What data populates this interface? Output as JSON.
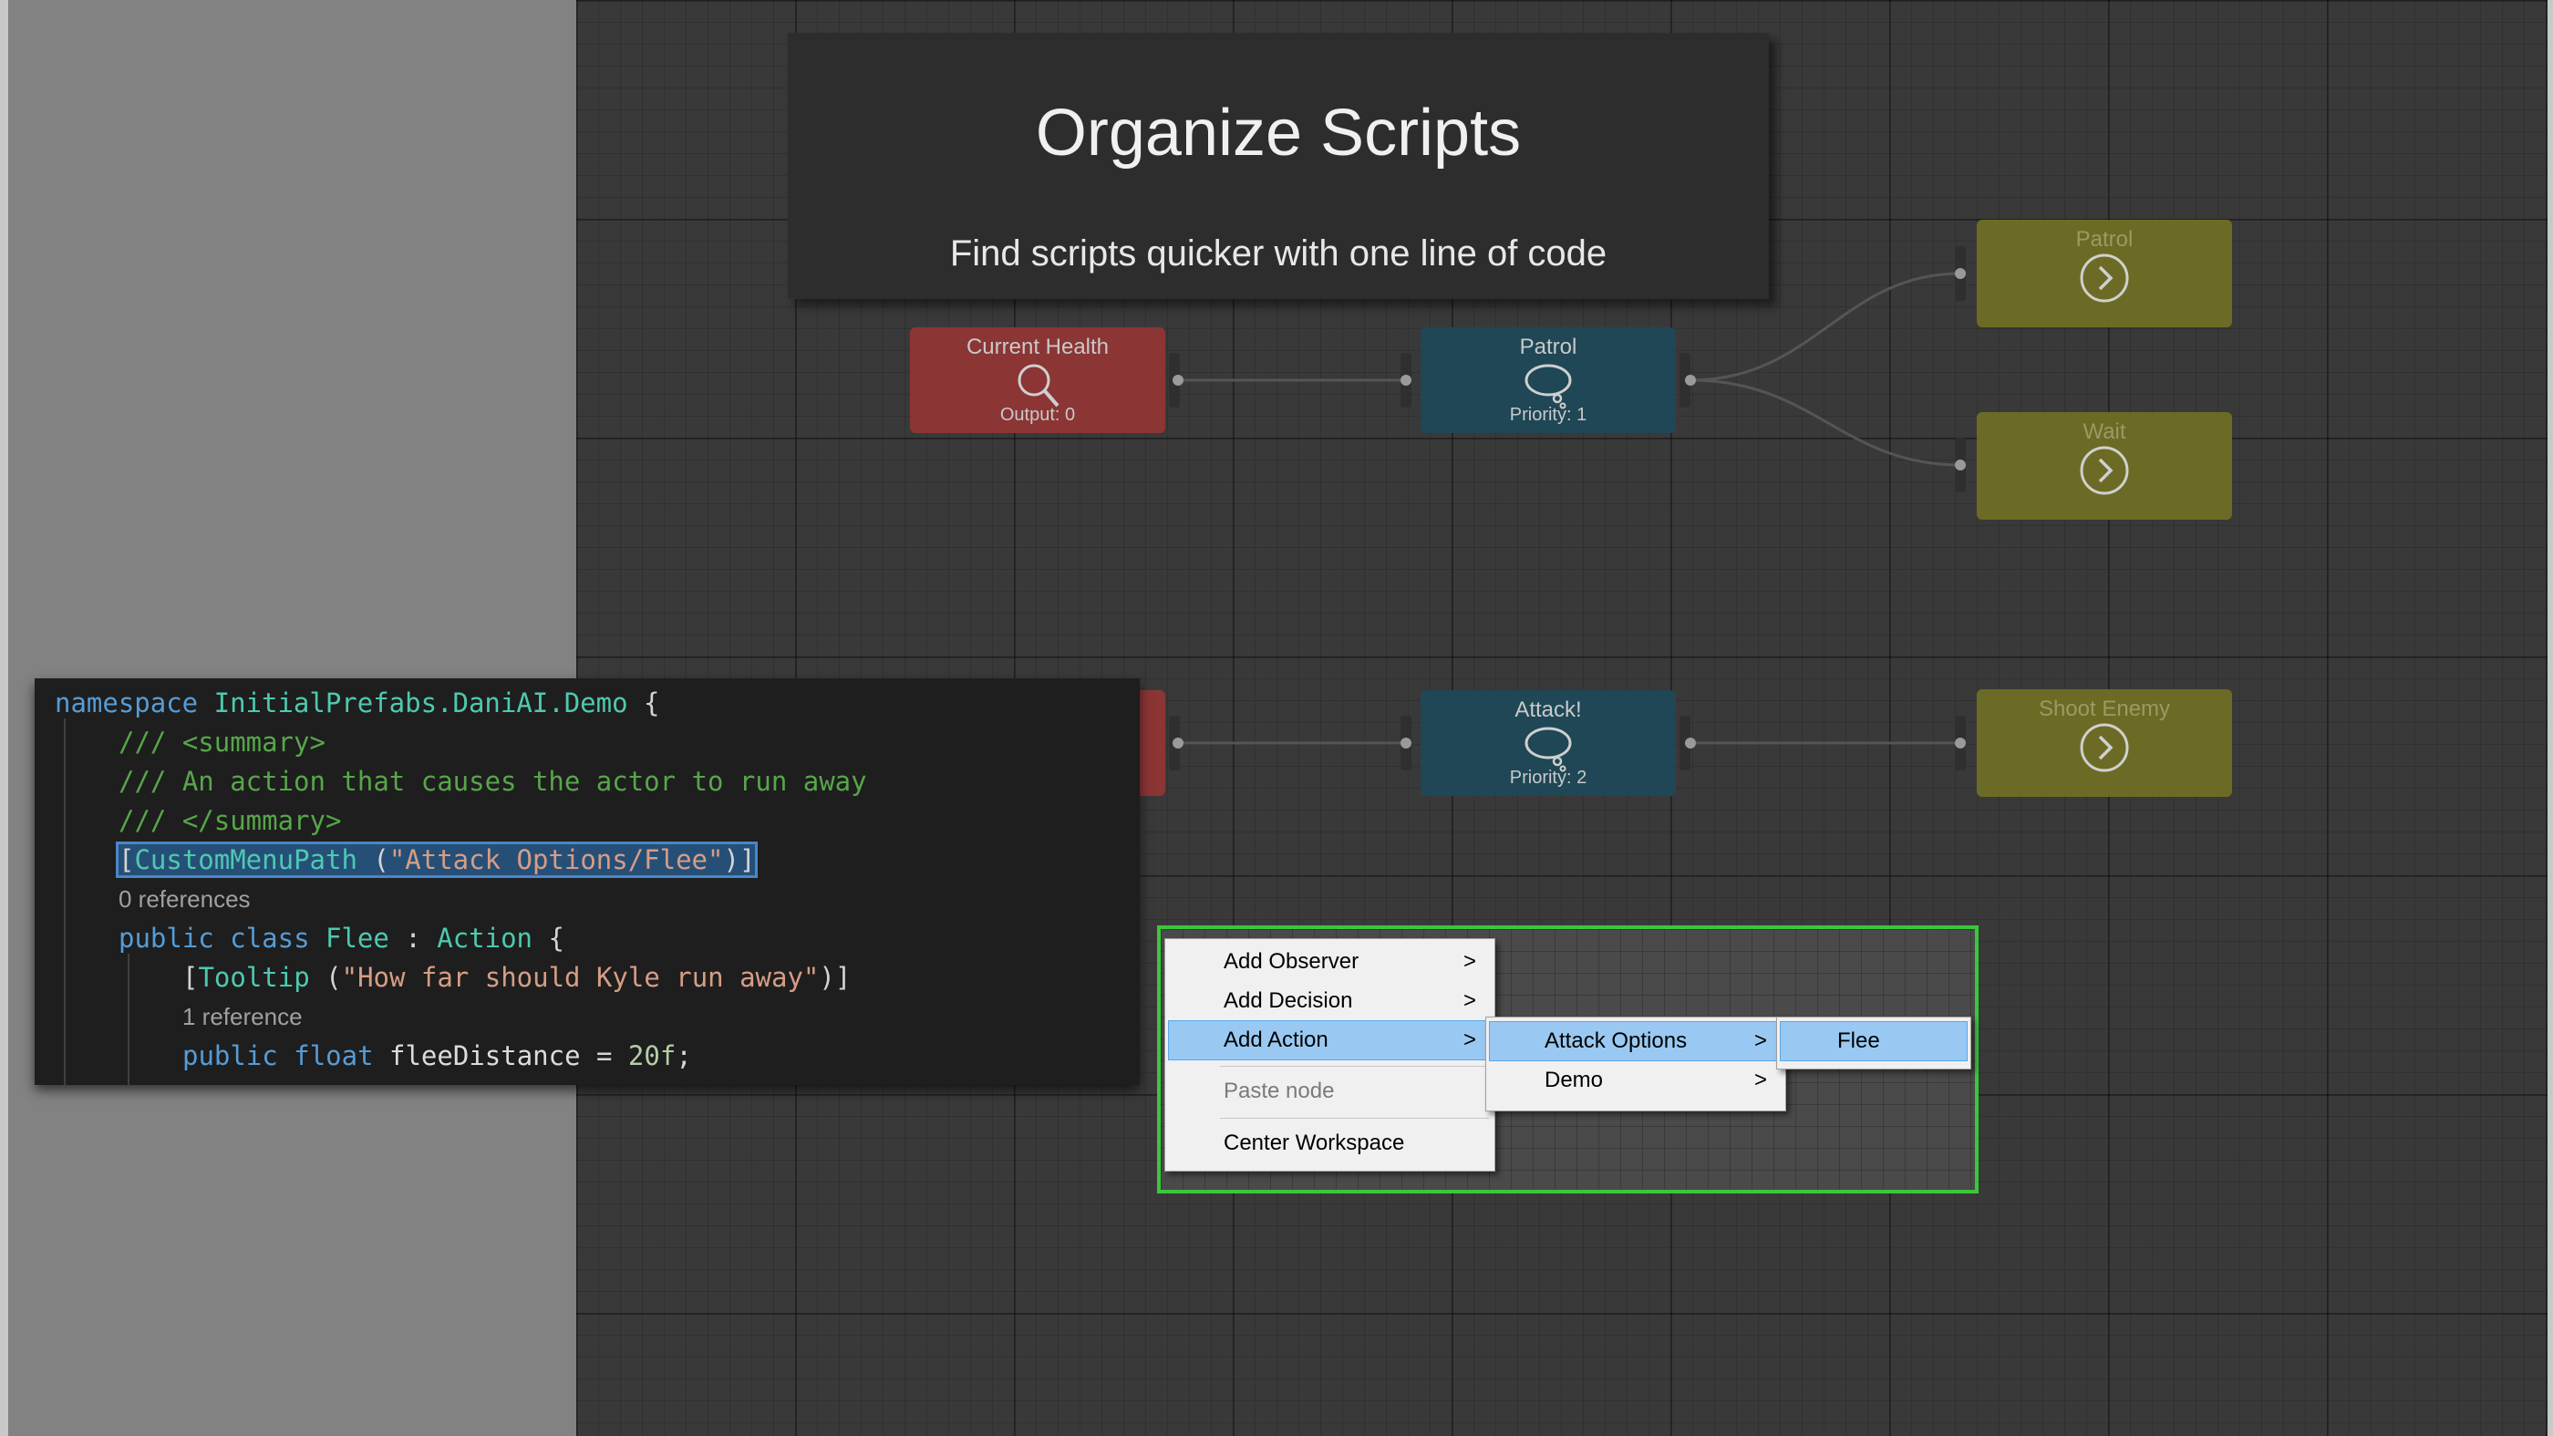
{
  "title_card": {
    "title": "Organize Scripts",
    "subtitle": "Find scripts quicker with one line of code"
  },
  "nodes": [
    {
      "name": "current-health",
      "title": "Current Health",
      "sub": "Output: 0",
      "color": "#8c3535",
      "icon": "magnifier-icon"
    },
    {
      "name": "patrol-decision",
      "title": "Patrol",
      "sub": "Priority: 1",
      "color": "#1f4756",
      "icon": "thought-bubble-icon"
    },
    {
      "name": "patrol-action",
      "title": "Patrol",
      "sub": "",
      "color": "#6c6b25",
      "icon": "arrow-circle-icon"
    },
    {
      "name": "wait-action",
      "title": "Wait",
      "sub": "",
      "color": "#6c6b25",
      "icon": "arrow-circle-icon"
    },
    {
      "name": "attack-decision",
      "title": "Attack!",
      "sub": "Priority: 2",
      "color": "#1f4756",
      "icon": "thought-bubble-icon"
    },
    {
      "name": "shoot-enemy-action",
      "title": "Shoot Enemy",
      "sub": "",
      "color": "#6c6b25",
      "icon": "arrow-circle-icon"
    }
  ],
  "code": {
    "l1": {
      "kw": "namespace",
      "ns": "InitialPrefabs.DaniAI.Demo",
      "brace": " {"
    },
    "l2": "/// <summary>",
    "l3": "/// An action that causes the actor to run away",
    "l4": "/// </summary>",
    "l5": {
      "open": "[",
      "attr": "CustomMenuPath",
      "mid": " (",
      "str": "\"Attack Options/Flee\"",
      "close": ")]"
    },
    "ref1": "0 references",
    "l6": {
      "kw1": "public",
      "kw2": "class",
      "name": "Flee",
      "sep": " : ",
      "base": "Action",
      "brace": " {"
    },
    "l7": {
      "open": "[",
      "attr": "Tooltip",
      "mid": " (",
      "str": "\"How far should Kyle run away\"",
      "close": ")]"
    },
    "ref2": "1 reference",
    "l8": {
      "kw1": "public",
      "kw2": "float",
      "name": "fleeDistance",
      "eq": " = ",
      "num": "20f",
      "end": ";"
    }
  },
  "context_menu": {
    "main": [
      {
        "label": "Add Observer",
        "submenu": true
      },
      {
        "label": "Add Decision",
        "submenu": true
      },
      {
        "label": "Add Action",
        "submenu": true,
        "selected": true
      },
      {
        "label": "Paste node",
        "disabled": true
      },
      {
        "label": "Center Workspace"
      }
    ],
    "action_sub": [
      {
        "label": "Attack Options",
        "submenu": true,
        "selected": true
      },
      {
        "label": "Demo",
        "submenu": true
      }
    ],
    "attack_sub": [
      {
        "label": "Flee",
        "selected": true
      }
    ],
    "arrow": ">"
  },
  "colors": {
    "highlight_frame": "#3bc73b",
    "selection": "#99c9f2"
  }
}
